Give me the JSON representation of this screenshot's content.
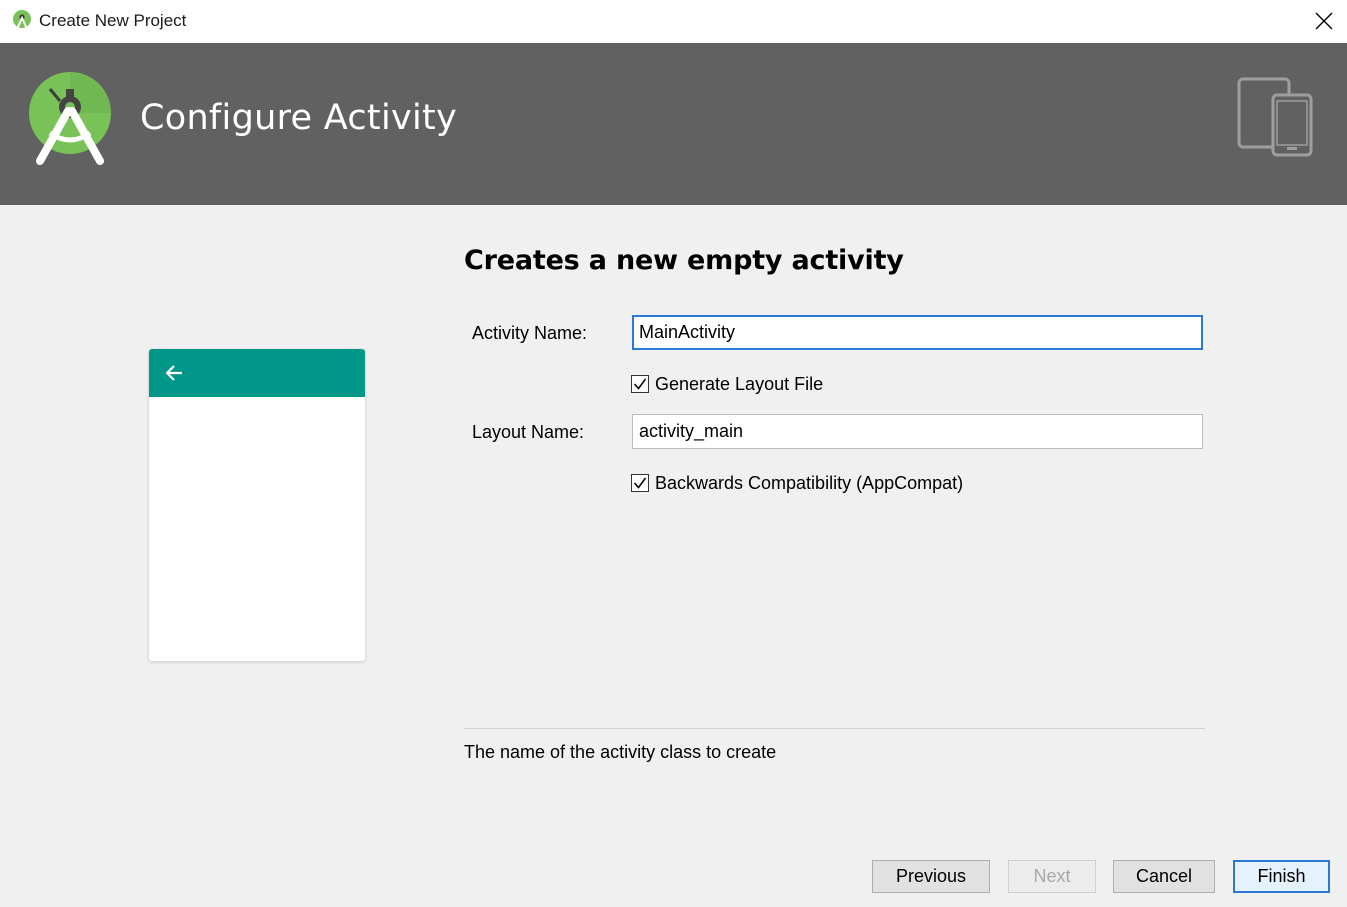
{
  "window": {
    "title": "Create New Project"
  },
  "header": {
    "title": "Configure Activity"
  },
  "form": {
    "heading": "Creates a new empty activity",
    "activity_name_label": "Activity Name:",
    "activity_name_value": "MainActivity",
    "generate_layout_label": "Generate Layout File",
    "generate_layout_checked": true,
    "layout_name_label": "Layout Name:",
    "layout_name_value": "activity_main",
    "backwards_compat_label": "Backwards Compatibility (AppCompat)",
    "backwards_compat_checked": true,
    "help_text": "The name of the activity class to create"
  },
  "buttons": {
    "previous": "Previous",
    "next": "Next",
    "cancel": "Cancel",
    "finish": "Finish"
  },
  "colors": {
    "header_bg": "#616161",
    "preview_toolbar": "#009688",
    "android_green": "#78c257",
    "focus_blue": "#2a7ad5"
  },
  "icons": {
    "window": "android-studio-icon",
    "close": "close-icon",
    "logo": "android-studio-logo",
    "devices": "devices-icon",
    "back": "back-arrow-icon",
    "check": "checkmark-icon"
  }
}
